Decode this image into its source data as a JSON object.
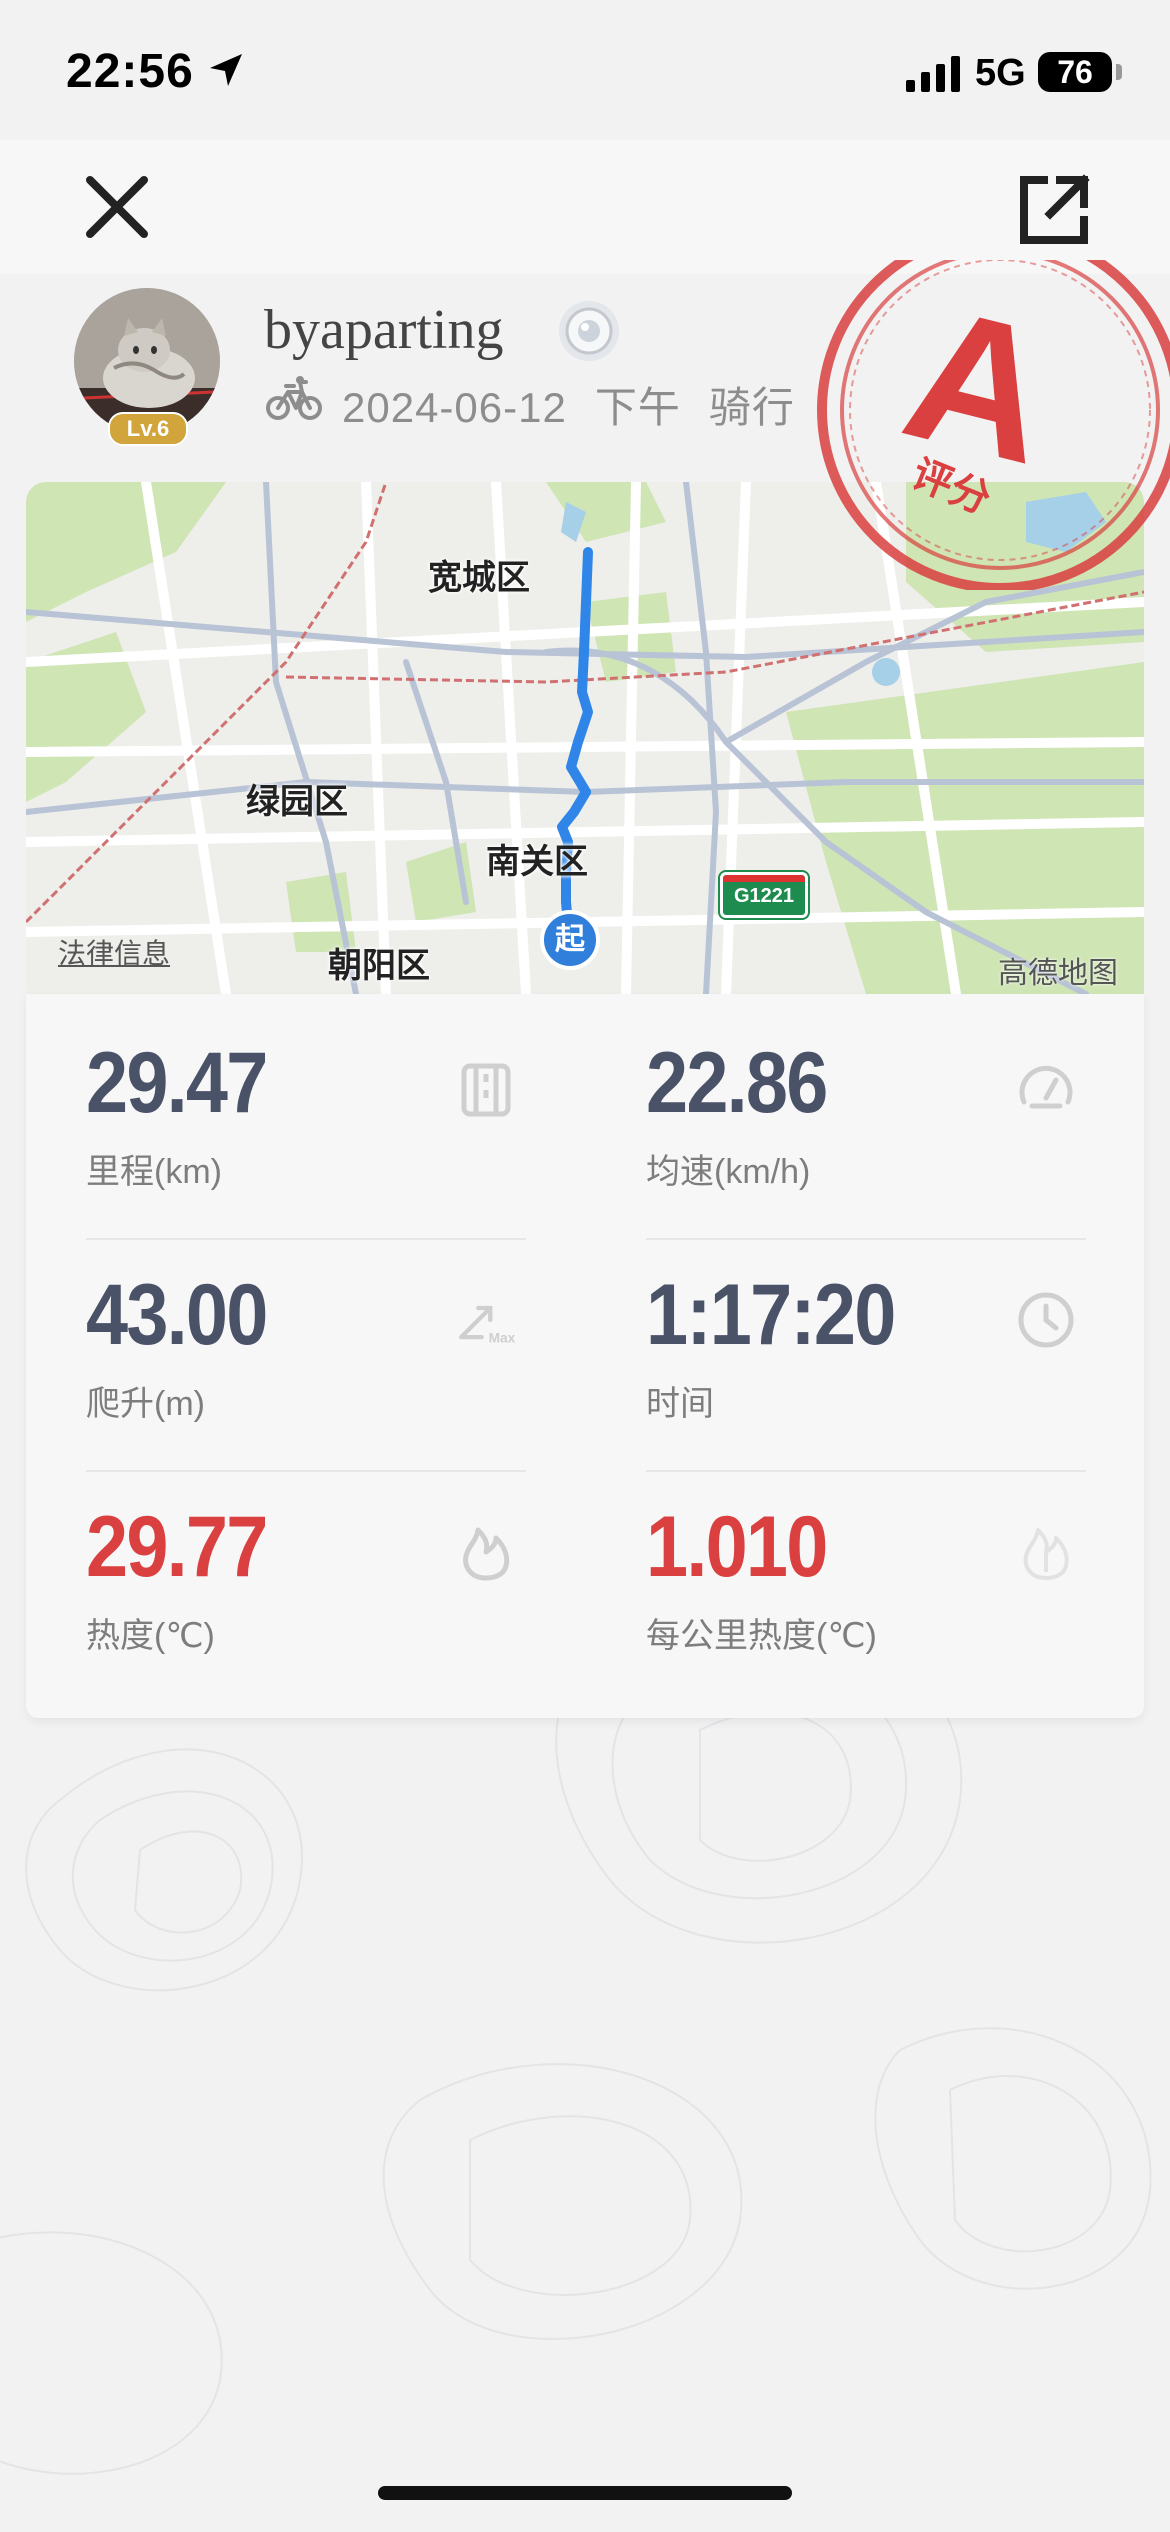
{
  "status_bar": {
    "time": "22:56",
    "network": "5G",
    "battery": "76"
  },
  "nav": {
    "close_icon": "close-icon",
    "share_icon": "share-export-icon"
  },
  "profile": {
    "username": "byaparting",
    "level": "Lv.6",
    "date": "2024-06-12",
    "period": "下午",
    "activity": "骑行"
  },
  "grade_stamp": {
    "grade": "A",
    "label": "评分",
    "color": "#d9403f"
  },
  "map": {
    "labels": {
      "kuancheng": "宽城区",
      "lvyuan": "绿园区",
      "nanguan": "南关区",
      "chaoyang": "朝阳区",
      "legal": "法律信息",
      "provider": "高德地图",
      "highway": "G1221",
      "start": "起"
    },
    "route_color": "#2f86e8"
  },
  "stats": {
    "distance": {
      "value": "29.47",
      "label": "里程(km)",
      "icon": "road-icon"
    },
    "avg_speed": {
      "value": "22.86",
      "label": "均速(km/h)",
      "icon": "speedometer-icon"
    },
    "climb": {
      "value": "43.00",
      "label": "爬升(m)",
      "icon": "climb-max-icon"
    },
    "duration": {
      "value": "1:17:20",
      "label": "时间",
      "icon": "clock-icon"
    },
    "heat": {
      "value": "29.77",
      "label": "热度(℃)",
      "icon": "flame-icon"
    },
    "heat_per_km": {
      "value": "1.010",
      "label": "每公里热度(℃)",
      "icon": "flame-outline-icon"
    }
  },
  "colors": {
    "value_dark": "#4a5268",
    "value_red": "#d9403f"
  }
}
